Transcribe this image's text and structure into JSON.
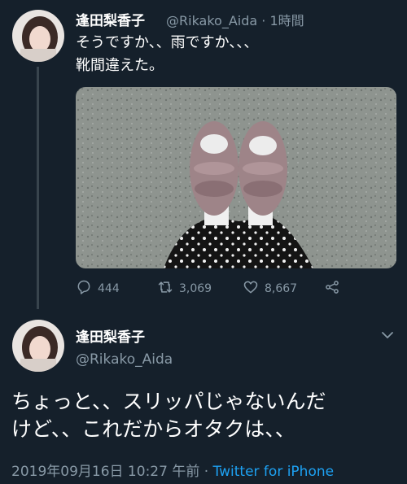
{
  "tweet1": {
    "display_name": "逢田梨香子",
    "handle": "@Rikako_Aida",
    "separator": " · ",
    "time": "1時間",
    "text": "そうですか、、雨ですか、、、\n靴間違えた。",
    "counts": {
      "replies": "444",
      "retweets": "3,069",
      "likes": "8,667"
    }
  },
  "tweet2": {
    "display_name": "逢田梨香子",
    "handle": "@Rikako_Aida",
    "text": "ちょっと、、スリッパじゃないんだ\nけど、、これだからオタクは、、",
    "timestamp": "2019年09月16日 10:27 午前",
    "separator": " · ",
    "source": "Twitter for iPhone"
  },
  "colors": {
    "background": "#15202b",
    "secondary_text": "#8899a6",
    "accent": "#1da1f2"
  }
}
